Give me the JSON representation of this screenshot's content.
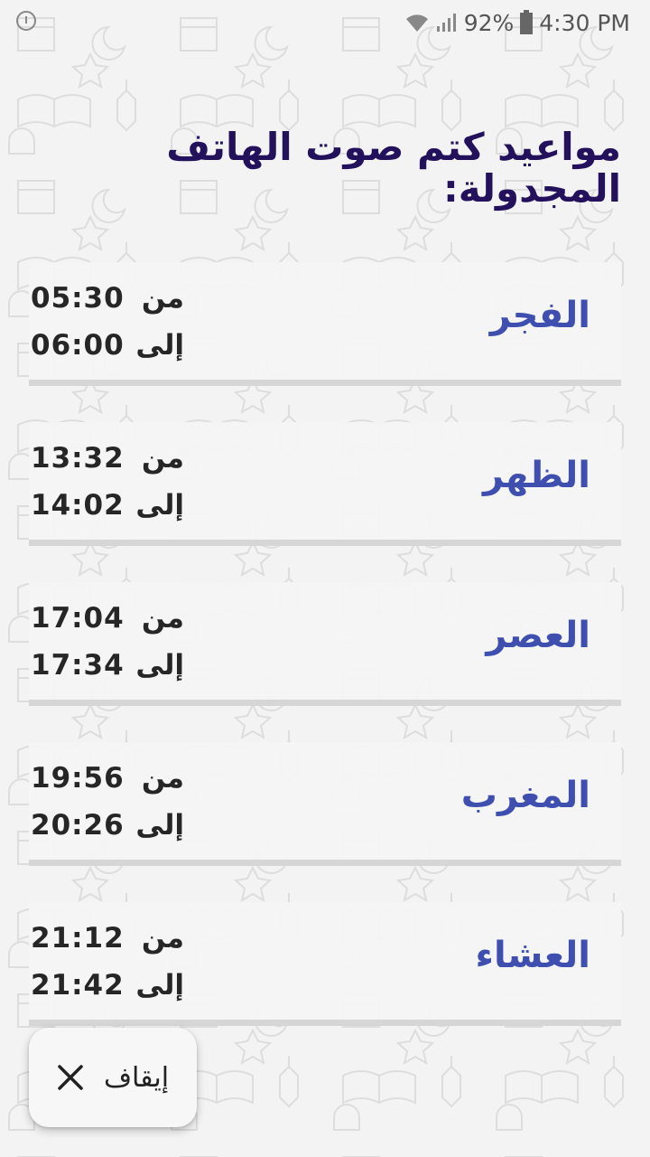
{
  "status_bar": {
    "battery_percent": "92%",
    "time": "4:30 PM",
    "icons": [
      "notification-icon",
      "wifi-icon",
      "signal-icon",
      "battery-icon"
    ]
  },
  "title": "مواعيد كتم صوت الهاتف المجدولة:",
  "schedule": [
    {
      "name": "الفجر",
      "from_label": "من",
      "from": "05:30",
      "to_label": "إلى",
      "to": "06:00"
    },
    {
      "name": "الظهر",
      "from_label": "من",
      "from": "13:32",
      "to_label": "إلى",
      "to": "14:02"
    },
    {
      "name": "العصر",
      "from_label": "من",
      "from": "17:04",
      "to_label": "إلى",
      "to": "17:34"
    },
    {
      "name": "المغرب",
      "from_label": "من",
      "from": "19:56",
      "to_label": "إلى",
      "to": "20:26"
    },
    {
      "name": "العشاء",
      "from_label": "من",
      "from": "21:12",
      "to_label": "إلى",
      "to": "21:42"
    }
  ],
  "stop_button": {
    "label": "إيقاف",
    "icon": "close-icon"
  },
  "colors": {
    "title": "#23115c",
    "prayer_name": "#3f4fb0",
    "time_text": "#262626",
    "background": "#f3f3f3"
  }
}
